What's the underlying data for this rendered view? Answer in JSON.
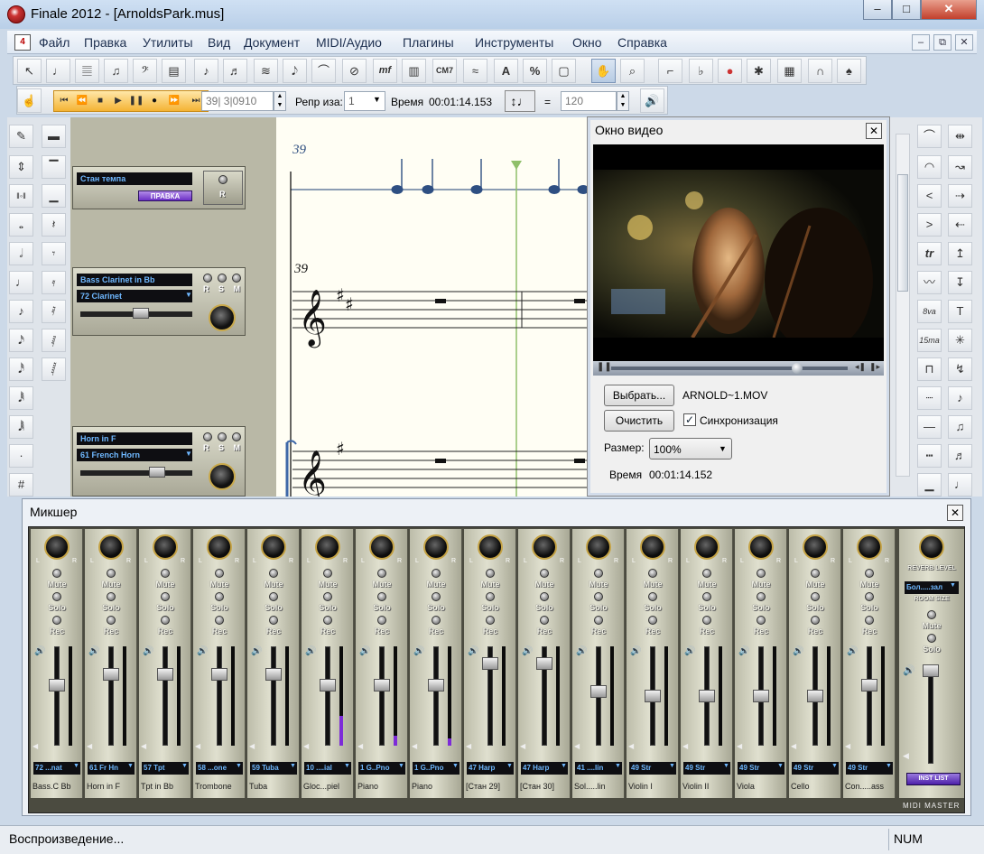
{
  "window": {
    "title": "Finale 2012 - [ArnoldsPark.mus]",
    "controls": [
      "–",
      "□",
      "✕"
    ]
  },
  "menu": {
    "items": [
      "Файл",
      "Правка",
      "Утилиты",
      "Вид",
      "Документ",
      "MIDI/Аудио",
      "Плагины",
      "Инструменты",
      "Окно",
      "Справка"
    ],
    "mdi_controls": [
      "–",
      "⧉",
      "✕"
    ]
  },
  "main_tools": [
    "↖",
    "♩",
    "𝄚",
    "♫",
    "𝄢",
    "▤",
    "♪",
    "♬",
    "≋",
    "𝅘𝅥𝅮",
    "⌒",
    "⊘",
    "mf",
    "▥",
    "CM7",
    "≈",
    "A",
    "%",
    "▢",
    "✋",
    "⌕",
    "⌐",
    "♭",
    "●",
    "✱",
    "▦",
    "∩",
    "♠"
  ],
  "playback": {
    "measure_position": "39| 3|0910",
    "repeat_label": "Репр иза:",
    "repeat_value": "1",
    "time_label": "Время",
    "time_value": "00:01:14.153",
    "equals": "=",
    "tempo_value": "120"
  },
  "score": {
    "measure_numbers": [
      "39",
      "39"
    ]
  },
  "studio_strips": [
    {
      "name": "Стан темпа",
      "badge": "ПРАВКА",
      "letters": "R"
    },
    {
      "name": "Bass Clarinet in Bb",
      "patch": "72 Clarinet",
      "letters": "R S M"
    },
    {
      "name": "Horn in F",
      "patch": "61 French Horn",
      "letters": "R S M"
    }
  ],
  "video": {
    "title": "Окно видео",
    "choose_label": "Выбрать...",
    "filename": "ARNOLD~1.MOV",
    "clear_label": "Очистить",
    "sync_label": "Синхронизация",
    "sync_checked": true,
    "size_label": "Размер:",
    "size_value": "100%",
    "time_label": "Время",
    "time_value": "00:01:14.152"
  },
  "mixer": {
    "title": "Микшер",
    "mute_label": "Mute",
    "solo_label": "Solo",
    "rec_label": "Rec",
    "channels": [
      {
        "patch": "72 ...nat",
        "name": "Bass.C Bb",
        "fader": 0.38,
        "meter": 0
      },
      {
        "patch": "61 Fr Hn",
        "name": "Horn in F",
        "fader": 0.25,
        "meter": 0
      },
      {
        "patch": "57 Tpt",
        "name": "Tpt in Bb",
        "fader": 0.25,
        "meter": 0
      },
      {
        "patch": "58 ...one",
        "name": "Trombone",
        "fader": 0.25,
        "meter": 0
      },
      {
        "patch": "59 Tuba",
        "name": "Tuba",
        "fader": 0.25,
        "meter": 0
      },
      {
        "patch": "10 ....ial",
        "name": "Gloc...piel",
        "fader": 0.38,
        "meter": 0.3
      },
      {
        "patch": "1 G..Pno",
        "name": "Piano",
        "fader": 0.38,
        "meter": 0.1
      },
      {
        "patch": "1 G..Pno",
        "name": "Piano",
        "fader": 0.38,
        "meter": 0.07
      },
      {
        "patch": "47 Harp",
        "name": "[Стан 29]",
        "fader": 0.12,
        "meter": 0
      },
      {
        "patch": "47 Harp",
        "name": "[Стан 30]",
        "fader": 0.12,
        "meter": 0
      },
      {
        "patch": "41 ....lin",
        "name": "Sol.....lin",
        "fader": 0.45,
        "meter": 0
      },
      {
        "patch": "49 Str",
        "name": "Violin I",
        "fader": 0.5,
        "meter": 0
      },
      {
        "patch": "49 Str",
        "name": "Violin II",
        "fader": 0.5,
        "meter": 0
      },
      {
        "patch": "49 Str",
        "name": "Viola",
        "fader": 0.5,
        "meter": 0
      },
      {
        "patch": "49 Str",
        "name": "Cello",
        "fader": 0.5,
        "meter": 0
      },
      {
        "patch": "49 Str",
        "name": "Con.....ass",
        "fader": 0.38,
        "meter": 0
      }
    ],
    "master": {
      "reverb_label": "REVERB LEVEL",
      "room_value": "Бол.....зал",
      "room_label": "ROOM SIZE",
      "inst_list_label": "INST LIST",
      "footer_label": "MIDI MASTER"
    }
  },
  "status": {
    "message": "Воспроизведение...",
    "num_indicator": "NUM"
  }
}
